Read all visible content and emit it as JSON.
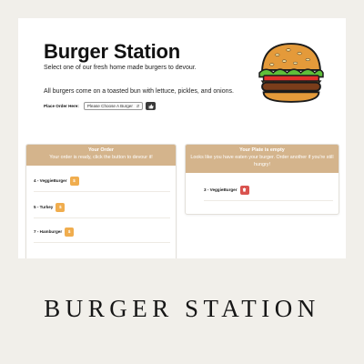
{
  "jumbotron": {
    "title": "Burger Station",
    "tagline": "Select one of our fresh home made burgers to devour.",
    "description": "All burgers come on a toasted bun with lettuce, pickles, and onions.",
    "order_label": "Place Order Here:",
    "select_value": "Please Choose A Burger"
  },
  "order_panel": {
    "title": "Your Order",
    "subtitle": "Your order is ready, click the button to devour it!",
    "items": [
      {
        "label": "4 - VeggieBurger",
        "button_icon": "devour-icon"
      },
      {
        "label": "5 - Turkey",
        "button_icon": "devour-icon"
      },
      {
        "label": "7 - Hamburger",
        "button_icon": "devour-icon"
      }
    ]
  },
  "plate_panel": {
    "title": "Your Plate is empty",
    "subtitle": "Looks like you have eaten your burger. Order another if you're still hungry!",
    "items": [
      {
        "label": "3 - VeggieBurger",
        "button_icon": "delete-icon"
      }
    ]
  },
  "colors": {
    "panel_header": "#d4b48c",
    "devour_button": "#f0ad4e",
    "delete_button": "#d9534f",
    "order_button": "#3a3a3a"
  },
  "brand": {
    "caption": "BURGER STATION"
  }
}
